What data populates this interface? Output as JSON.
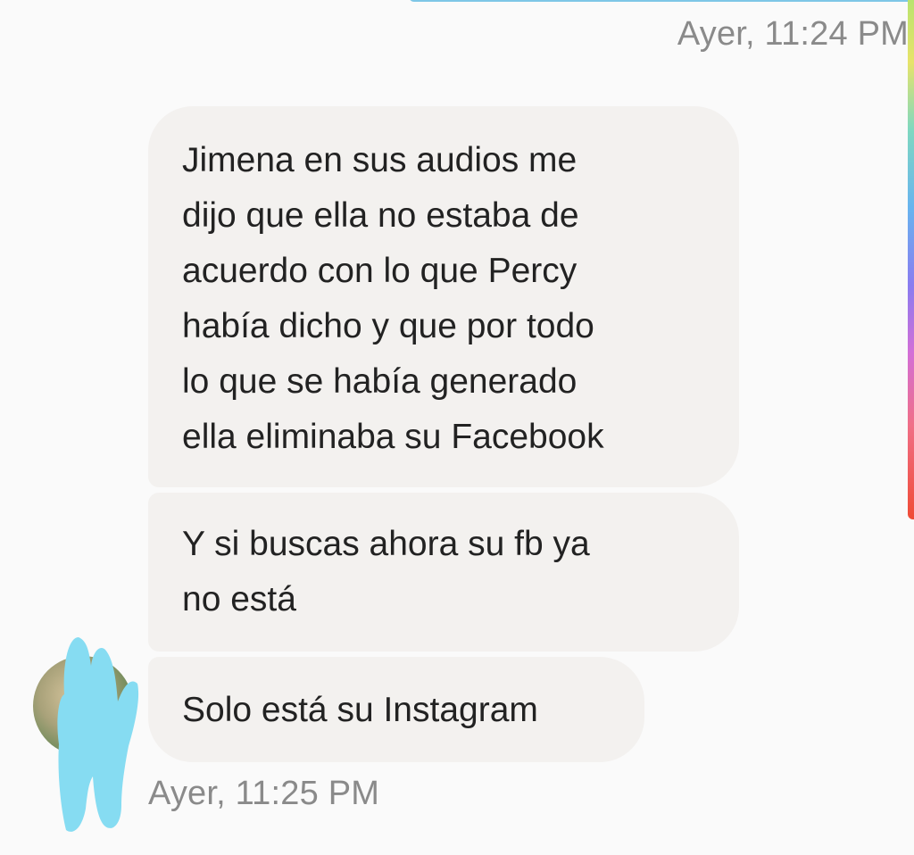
{
  "conversation": {
    "timestamp_top": "Ayer, 11:24 PM",
    "messages": [
      {
        "lines": [
          "Jimena en sus audios me",
          "dijo que ella no estaba de",
          "acuerdo con lo que Percy",
          "había dicho y que por todo",
          "lo que se había generado",
          "ella eliminaba su Facebook"
        ]
      },
      {
        "lines": [
          "Y si buscas ahora su fb ya",
          "no está"
        ]
      },
      {
        "lines": [
          "Solo está su Instagram"
        ]
      }
    ],
    "timestamp_bottom": "Ayer, 11:25 PM"
  },
  "colors": {
    "background": "#fafafa",
    "bubble": "#f3f1ef",
    "text": "#222222",
    "timestamp": "#8a8a8a",
    "redaction": "#86dcf2",
    "top_bubble_edge": "#7ec6e6"
  },
  "icons": {
    "avatar": "contact-avatar",
    "redaction": "redaction-scribble"
  }
}
